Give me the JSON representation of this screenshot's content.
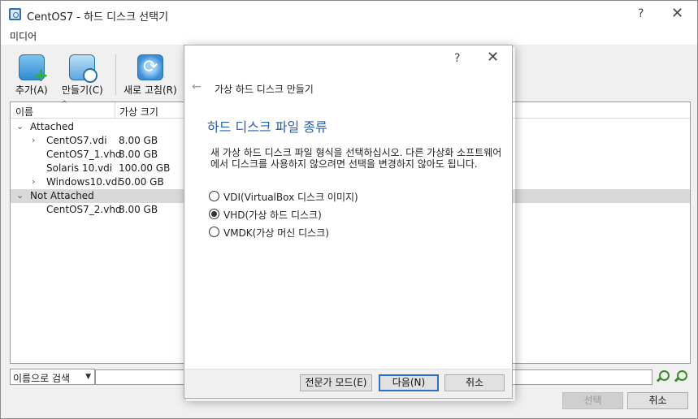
{
  "window": {
    "title": "CentOS7 - 하드 디스크 선택기",
    "help": "?",
    "close": "✕"
  },
  "menubar": {
    "media": "미디어"
  },
  "toolbar": {
    "add": "추가(A)",
    "create": "만들기(C)",
    "refresh": "새로 고침(R)"
  },
  "tree": {
    "columns": {
      "name": "이름",
      "size": "가상 크기"
    },
    "groups": [
      {
        "label": "Attached",
        "items": [
          {
            "name": "CentOS7.vdi",
            "size": "8.00 GB",
            "expandable": true
          },
          {
            "name": "CentOS7_1.vhd",
            "size": "8.00 GB",
            "expandable": false
          },
          {
            "name": "Solaris 10.vdi",
            "size": "100.00 GB",
            "expandable": false
          },
          {
            "name": "Windows10.vdi",
            "size": "50.00 GB",
            "expandable": true
          }
        ]
      },
      {
        "label": "Not Attached",
        "items": [
          {
            "name": "CentOS7_2.vhd",
            "size": "8.00 GB",
            "expandable": false
          }
        ]
      }
    ]
  },
  "search": {
    "mode": "이름으로 검색",
    "value": ""
  },
  "main_buttons": {
    "choose": "선택",
    "cancel": "취소"
  },
  "dialog": {
    "help": "?",
    "close": "✕",
    "wizard_title": "가상 하드 디스크 만들기",
    "heading": "하드 디스크 파일 종류",
    "description": "새 가상 하드 디스크 파일 형식을 선택하십시오. 다른 가상화 소프트웨어에서 디스크를 사용하지 않으려면 선택을 변경하지 않아도 됩니다.",
    "options": [
      {
        "label": "VDI(VirtualBox 디스크 이미지)",
        "selected": false
      },
      {
        "label": "VHD(가상 하드 디스크)",
        "selected": true
      },
      {
        "label": "VMDK(가상 머신 디스크)",
        "selected": false
      }
    ],
    "expert_button": "전문가 모드(E)",
    "next_button": "다음(N)",
    "cancel_button": "취소"
  }
}
